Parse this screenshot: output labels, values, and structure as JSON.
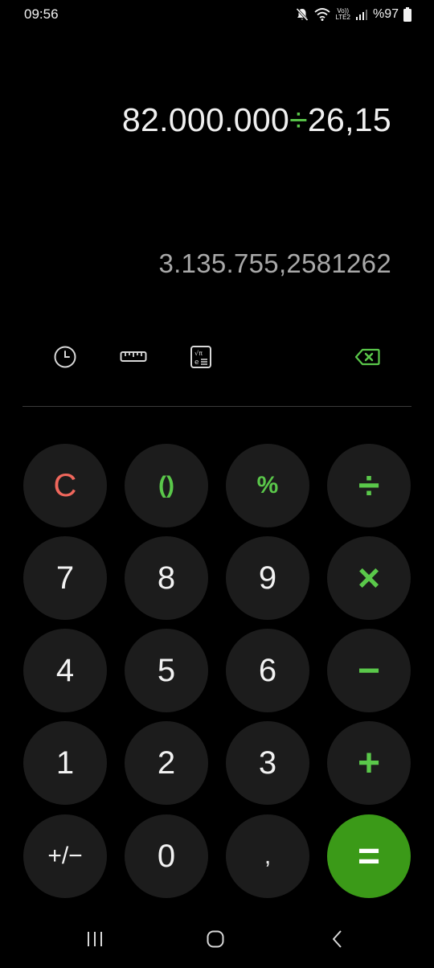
{
  "status_bar": {
    "time": "09:56",
    "network_label_top": "Vo))",
    "network_label_bottom": "LTE2",
    "battery_percent": "%97"
  },
  "display": {
    "expression_left": "82.000.000",
    "expression_operator": "÷",
    "expression_right": "26,15",
    "result": "3.135.755,2581262"
  },
  "toolbar": {
    "history_icon": "clock-icon",
    "unit_converter_icon": "ruler-icon",
    "scientific_icon": "scientific-calculator-icon",
    "backspace_icon": "backspace-icon",
    "backspace_color": "#5ac84a"
  },
  "keypad": {
    "row1": [
      "C",
      "()",
      "%",
      "÷"
    ],
    "row2": [
      "7",
      "8",
      "9",
      "×"
    ],
    "row3": [
      "4",
      "5",
      "6",
      "−"
    ],
    "row4": [
      "1",
      "2",
      "3",
      "+"
    ],
    "row5": [
      "+/−",
      "0",
      ",",
      "="
    ]
  },
  "colors": {
    "background": "#000000",
    "key_background": "#1c1c1c",
    "accent_green": "#5ac84a",
    "equals_background": "#3b9a18",
    "clear_red": "#f0675c",
    "result_gray": "#a9a9a9"
  },
  "nav_bar": {
    "recents_icon": "recents-icon",
    "home_icon": "home-icon",
    "back_icon": "back-icon"
  }
}
